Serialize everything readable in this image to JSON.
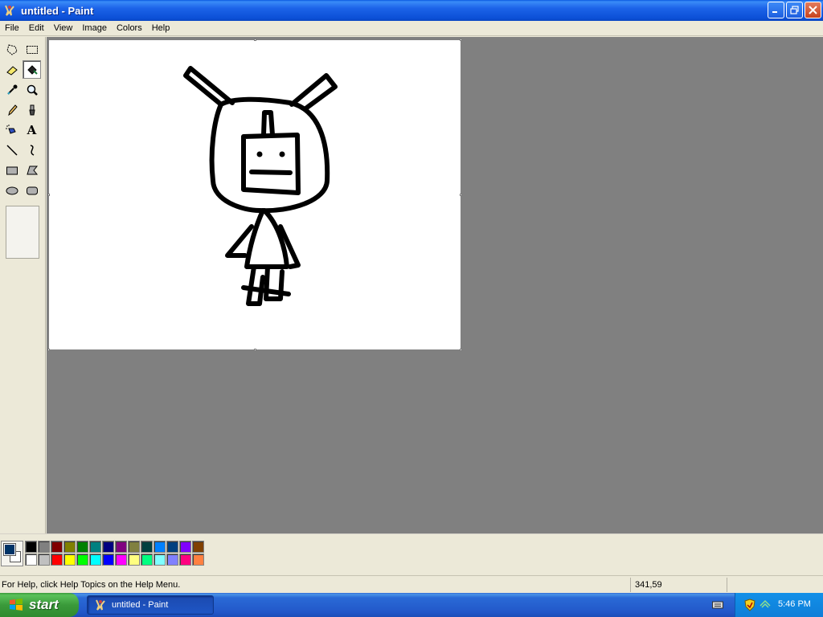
{
  "window": {
    "title": "untitled - Paint"
  },
  "menu": [
    "File",
    "Edit",
    "View",
    "Image",
    "Colors",
    "Help"
  ],
  "tools": [
    {
      "name": "free-form-select"
    },
    {
      "name": "select"
    },
    {
      "name": "eraser"
    },
    {
      "name": "fill-with-color",
      "selected": true
    },
    {
      "name": "pick-color"
    },
    {
      "name": "magnifier"
    },
    {
      "name": "pencil"
    },
    {
      "name": "brush"
    },
    {
      "name": "airbrush"
    },
    {
      "name": "text",
      "glyph": "A"
    },
    {
      "name": "line"
    },
    {
      "name": "curve"
    },
    {
      "name": "rectangle"
    },
    {
      "name": "polygon"
    },
    {
      "name": "ellipse"
    },
    {
      "name": "rounded-rectangle"
    }
  ],
  "palette": {
    "foreground": "#003366",
    "background": "#ffffff",
    "row1": [
      "#000000",
      "#808080",
      "#800000",
      "#808000",
      "#008000",
      "#008080",
      "#000080",
      "#800080",
      "#808040",
      "#004040",
      "#0080ff",
      "#004080",
      "#8000ff",
      "#804000"
    ],
    "row2": [
      "#ffffff",
      "#c0c0c0",
      "#ff0000",
      "#ffff00",
      "#00ff00",
      "#00ffff",
      "#0000ff",
      "#ff00ff",
      "#ffff80",
      "#00ff80",
      "#80ffff",
      "#8080ff",
      "#ff0080",
      "#ff8040"
    ]
  },
  "status": {
    "help": "For Help, click Help Topics on the Help Menu.",
    "coords": "341,59"
  },
  "taskbar": {
    "start_label": "start",
    "task_label": "untitled - Paint",
    "clock": "5:46 PM"
  }
}
